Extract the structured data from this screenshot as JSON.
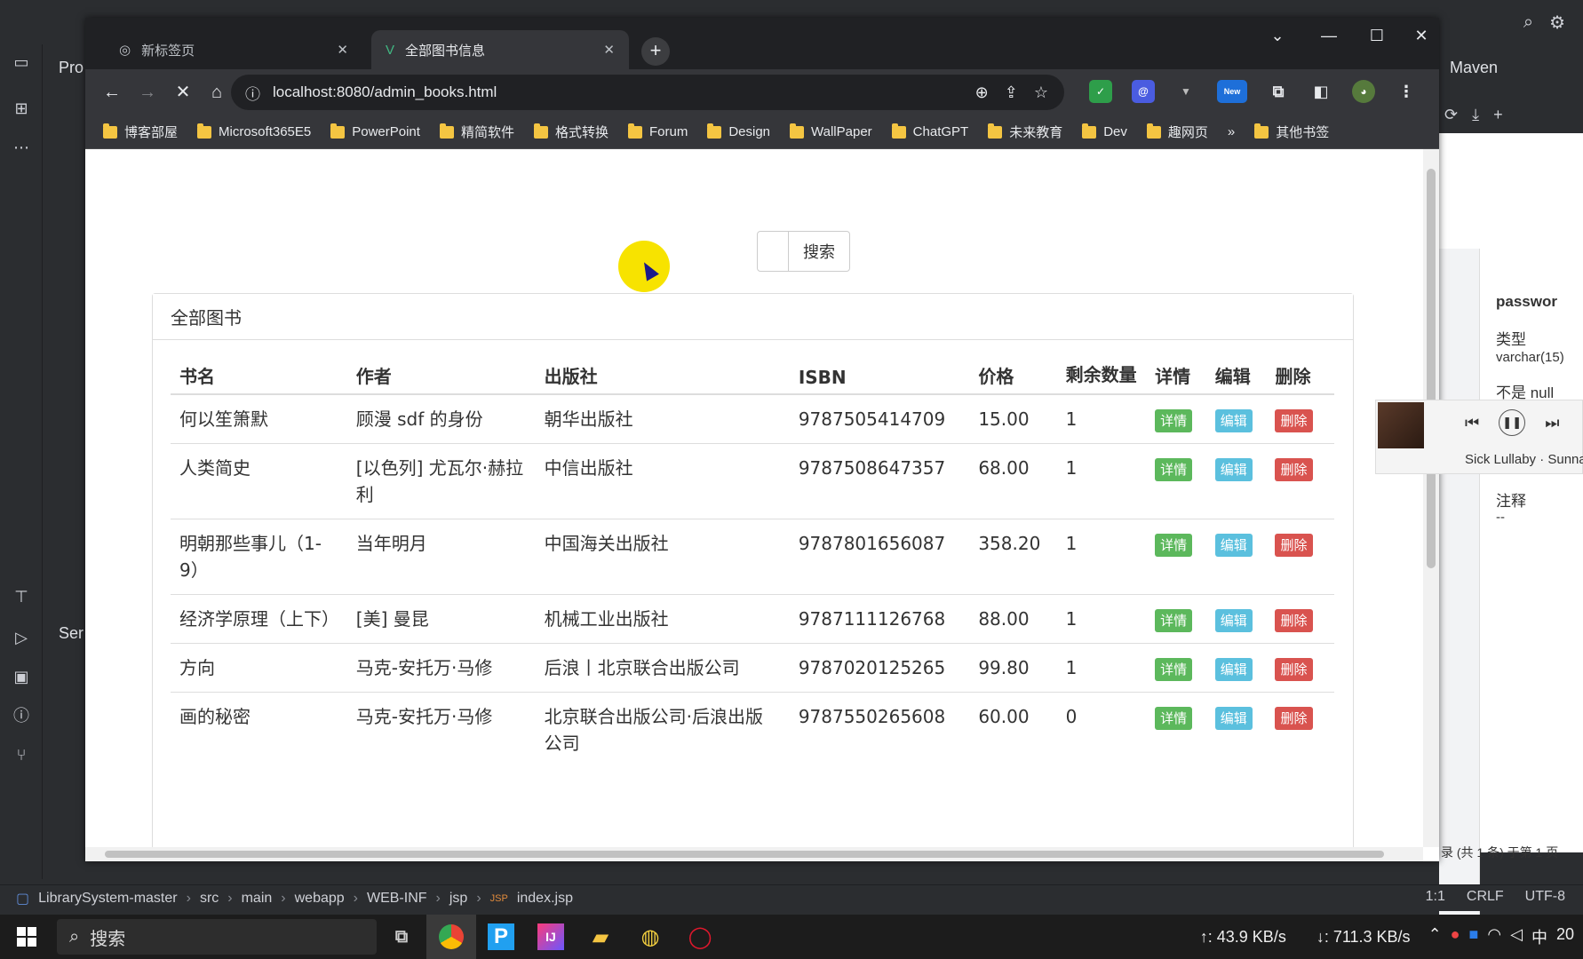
{
  "ide": {
    "project_label": "Pro",
    "services_label": "Ser",
    "maven_label": "Maven",
    "db_props": {
      "column": "passwor",
      "type_label": "类型",
      "type_value": "varchar(15)",
      "notnull_label": "不是 null",
      "comment_label": "注释",
      "comment_value": "--",
      "record_status": "录 (共 1 条) 于第 1 页"
    },
    "breadcrumb": [
      "LibrarySystem-master",
      "src",
      "main",
      "webapp",
      "WEB-INF",
      "jsp",
      "index.jsp"
    ],
    "status": {
      "position": "1:1",
      "line_sep": "CRLF",
      "encoding": "UTF-8"
    }
  },
  "browser": {
    "tabs": [
      {
        "title": "新标签页"
      },
      {
        "title": "全部图书信息"
      }
    ],
    "url": "localhost:8080/admin_books.html",
    "bookmarks": [
      "博客部屋",
      "Microsoft365E5",
      "PowerPoint",
      "精简软件",
      "格式转换",
      "Forum",
      "Design",
      "WallPaper",
      "ChatGPT",
      "未来教育",
      "Dev",
      "趣网页"
    ],
    "bookmarks_more": "»",
    "other_bookmarks": "其他书签",
    "ext_new_badge": "New"
  },
  "page": {
    "search_button": "搜索",
    "search_placeholder": "",
    "panel_title": "全部图书",
    "columns": [
      "书名",
      "作者",
      "出版社",
      "ISBN",
      "价格",
      "剩余数量",
      "详情",
      "编辑",
      "删除"
    ],
    "detail_label": "详情",
    "edit_label": "编辑",
    "delete_label": "删除",
    "books": [
      {
        "name": "何以笙箫默",
        "author": "顾漫 sdf 的身份",
        "publisher": "朝华出版社",
        "isbn": "9787505414709",
        "price": "15.00",
        "count": "1"
      },
      {
        "name": "人类简史",
        "author": "[以色列] 尤瓦尔·赫拉利",
        "publisher": "中信出版社",
        "isbn": "9787508647357",
        "price": "68.00",
        "count": "1"
      },
      {
        "name": "明朝那些事儿（1-9）",
        "author": "当年明月",
        "publisher": "中国海关出版社",
        "isbn": "9787801656087",
        "price": "358.20",
        "count": "1"
      },
      {
        "name": "经济学原理（上下）",
        "author": "[美] 曼昆",
        "publisher": "机械工业出版社",
        "isbn": "9787111126768",
        "price": "88.00",
        "count": "1"
      },
      {
        "name": "方向",
        "author": "马克-安托万·马修",
        "publisher": "后浪丨北京联合出版公司",
        "isbn": "9787020125265",
        "price": "99.80",
        "count": "1"
      },
      {
        "name": "画的秘密",
        "author": "马克-安托万·马修",
        "publisher": "北京联合出版公司·后浪出版公司",
        "isbn": "9787550265608",
        "price": "60.00",
        "count": "0"
      }
    ]
  },
  "music": {
    "title": "Sick Lullaby · Sunna"
  },
  "taskbar": {
    "search_label": "搜索",
    "upload_speed": "↑: 43.9 KB/s",
    "download_speed": "↓: 711.3 KB/s",
    "ime": "中",
    "clock_partial": "20"
  }
}
